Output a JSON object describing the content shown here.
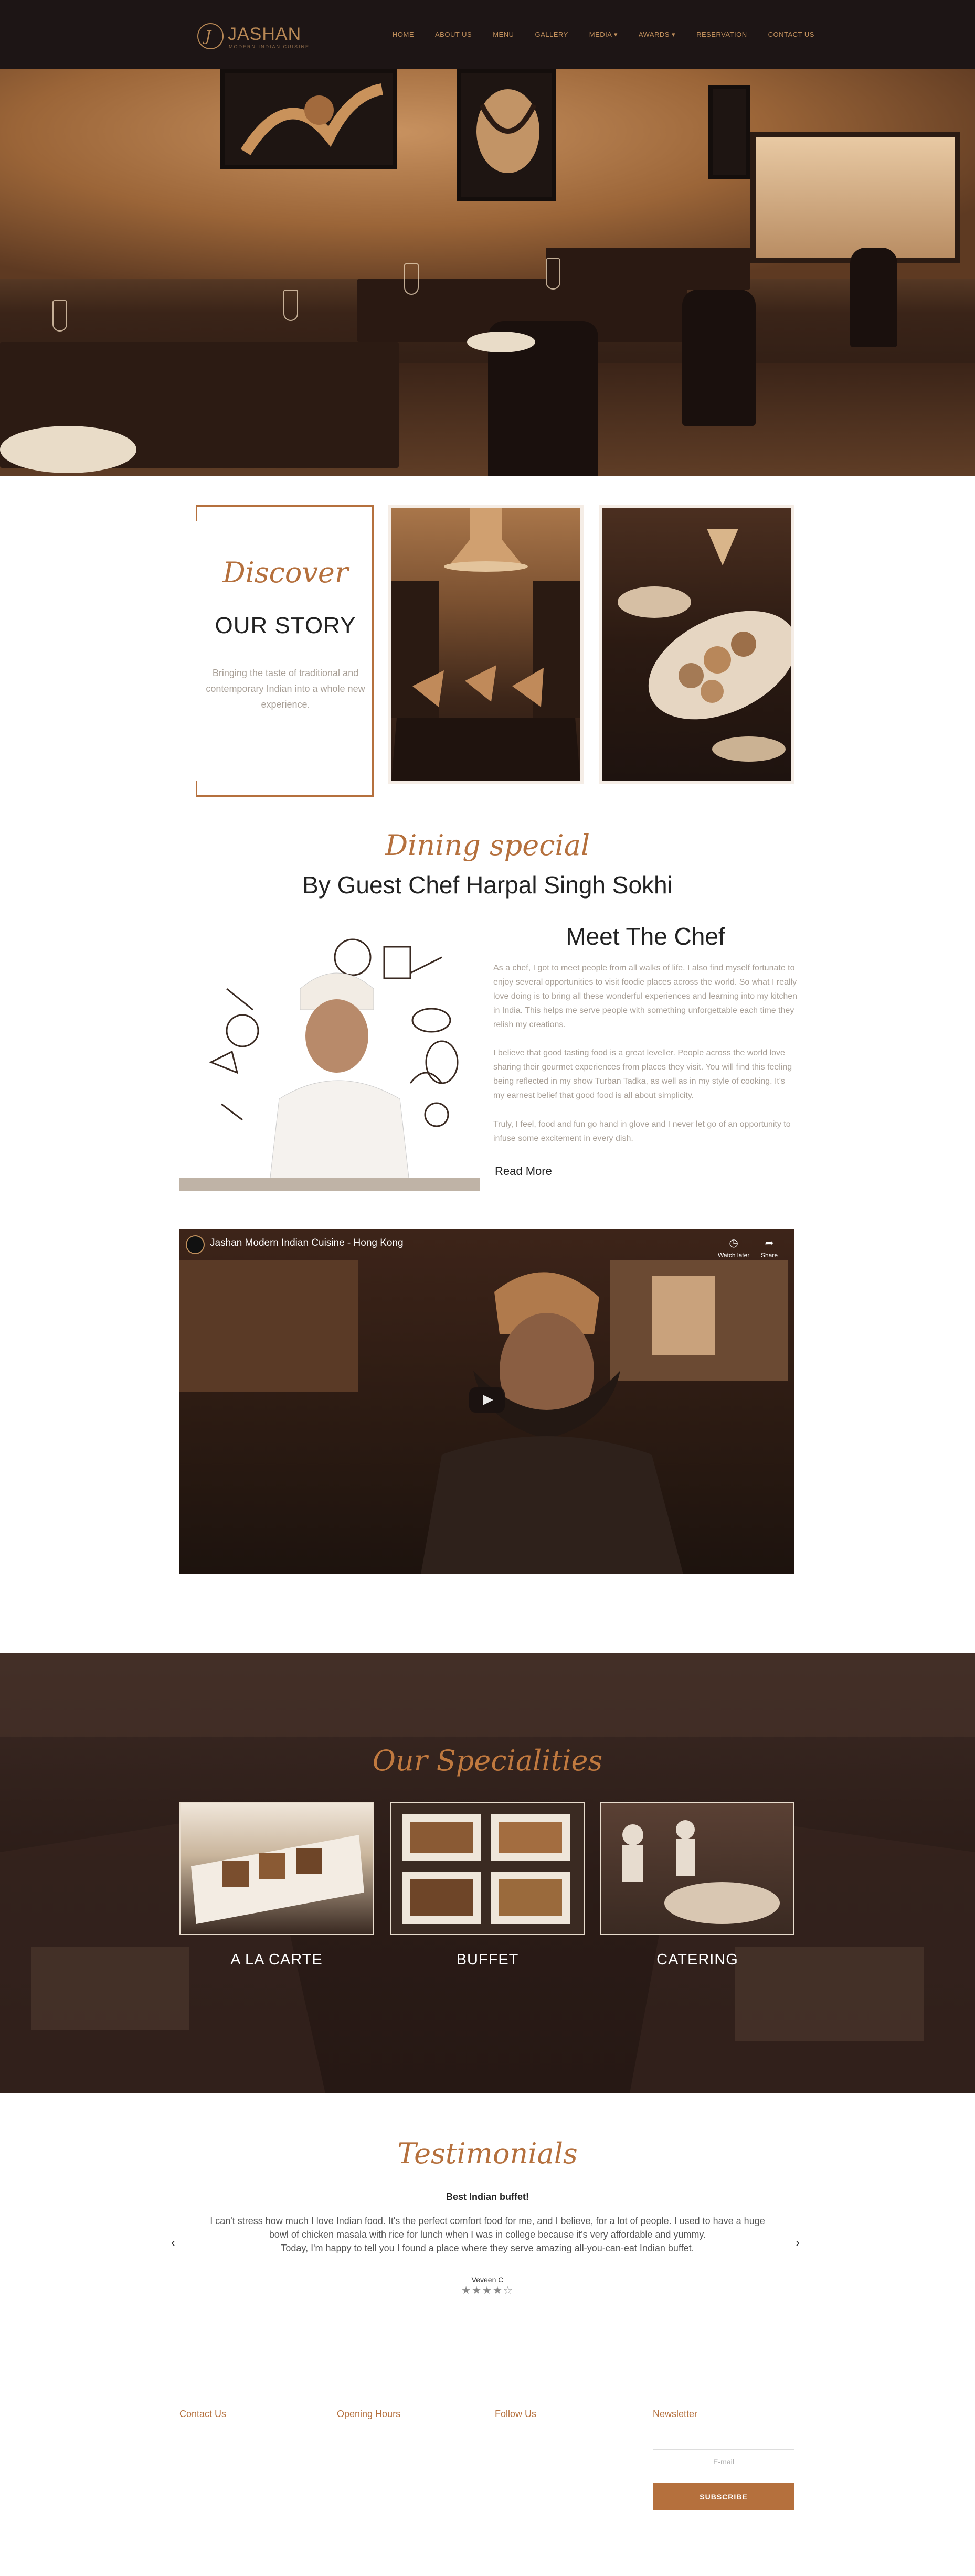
{
  "header": {
    "logo_name": "JASHAN",
    "logo_tagline": "MODERN INDIAN CUISINE",
    "nav": [
      {
        "label": "HOME"
      },
      {
        "label": "ABOUT US"
      },
      {
        "label": "MENU"
      },
      {
        "label": "GALLERY"
      },
      {
        "label": "MEDIA ▾"
      },
      {
        "label": "AWARDS ▾"
      },
      {
        "label": "RESERVATION"
      },
      {
        "label": "CONTACT US"
      }
    ]
  },
  "hero": {
    "slide_index": 1,
    "slide_count": 3
  },
  "story": {
    "script": "Discover",
    "title": "OUR STORY",
    "text": "Bringing the taste of traditional and contemporary Indian into a whole new experience."
  },
  "dining": {
    "script": "Dining special",
    "title": "By Guest Chef Harpal Singh Sokhi",
    "chef_title": "Meet The Chef",
    "para1": "As a chef, I got to meet people from all walks of life. I also find myself fortunate to enjoy several opportunities to visit foodie places across the world. So what I really love doing is to bring all these wonderful experiences and learning into my kitchen in India. This helps me serve people with something unforgettable each time they relish my creations.",
    "para2": "I believe that good tasting food is a great leveller. People across the world love sharing their gourmet experiences from places they visit. You will find this feeling being reflected in my show Turban Tadka, as well as in my style of cooking. It's my earnest belief that good food is all about simplicity.",
    "para3": "Truly, I feel, food and fun go hand in glove and I never let go of an opportunity to infuse some excitement in every dish.",
    "read_more": "Read More"
  },
  "video": {
    "title": "Jashan Modern Indian Cuisine - Hong Kong",
    "watch_later": "Watch later",
    "share": "Share"
  },
  "specialities": {
    "script": "Our Specialities",
    "items": [
      {
        "label": "A LA CARTE"
      },
      {
        "label": "BUFFET"
      },
      {
        "label": "CATERING"
      }
    ]
  },
  "testimonials": {
    "script": "Testimonials",
    "heading": "Best Indian buffet!",
    "lines": [
      "I can't stress how much I love Indian food. It's the perfect comfort food for me, and I believe, for a lot of people. I used to have a huge",
      "bowl of chicken masala with rice for lunch when I was in college because it's very affordable and yummy.",
      "Today, I'm happy to tell you I found a place where they serve amazing all-you-can-eat Indian buffet."
    ],
    "author": "Veveen C",
    "rating": 4,
    "rating_max": 5,
    "stars": "★★★★☆",
    "prev": "‹",
    "next": "›"
  },
  "footer": {
    "contact": "Contact Us",
    "hours": "Opening Hours",
    "follow": "Follow Us",
    "newsletter": "Newsletter",
    "email_placeholder": "E-mail",
    "subscribe": "SUBSCRIBE"
  },
  "colors": {
    "accent": "#b5703d",
    "header_bg": "#1d1515",
    "dark_section": "#2b1c17"
  }
}
